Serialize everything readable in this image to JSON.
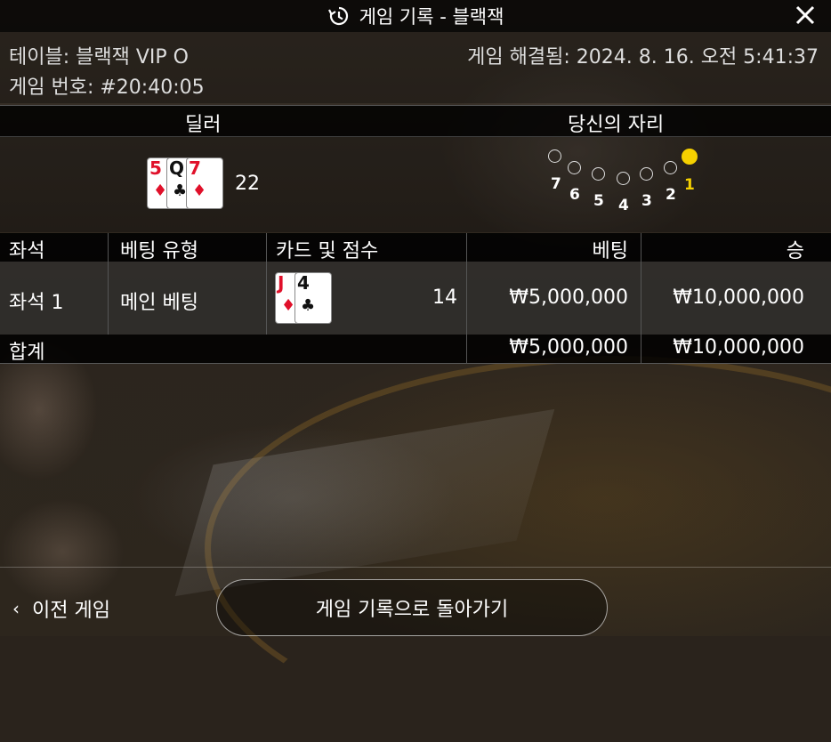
{
  "title": "게임 기록 - 블랙잭",
  "info": {
    "table": "테이블: 블랙잭 VIP O",
    "game_number": "게임 번호: #20:40:05",
    "resolved": "게임 해결됨: 2024. 8. 16. 오전 5:41:37"
  },
  "sections": {
    "dealer": "딜러",
    "your_seat": "당신의 자리"
  },
  "dealer": {
    "cards": [
      {
        "rank": "5",
        "suit": "♦",
        "color": "red"
      },
      {
        "rank": "Q",
        "suit": "♣",
        "color": "black"
      },
      {
        "rank": "7",
        "suit": "♦",
        "color": "red"
      }
    ],
    "score": "22"
  },
  "seats": [
    {
      "label": "7",
      "active": false
    },
    {
      "label": "6",
      "active": false
    },
    {
      "label": "5",
      "active": false
    },
    {
      "label": "4",
      "active": false
    },
    {
      "label": "3",
      "active": false
    },
    {
      "label": "2",
      "active": false
    },
    {
      "label": "1",
      "active": true
    }
  ],
  "table": {
    "headers": [
      "좌석",
      "베팅 유형",
      "카드 및 점수",
      "베팅",
      "승"
    ],
    "rows": [
      {
        "seat": "좌석 1",
        "bet_type": "메인 베팅",
        "cards": [
          {
            "rank": "J",
            "suit": "♦",
            "color": "red"
          },
          {
            "rank": "4",
            "suit": "♣",
            "color": "black"
          }
        ],
        "score": "14",
        "bet": "₩5,000,000",
        "win": "₩10,000,000"
      }
    ],
    "total": {
      "label": "합계",
      "bet": "₩5,000,000",
      "win": "₩10,000,000"
    }
  },
  "footer": {
    "prev": "이전 게임",
    "back": "게임 기록으로 돌아가기"
  },
  "colors": {
    "active_seat": "#f5d000",
    "red_suit": "#e0102a"
  },
  "icons": {
    "history": "history-icon",
    "close": "close-icon",
    "prev": "chevron-left-icon"
  }
}
